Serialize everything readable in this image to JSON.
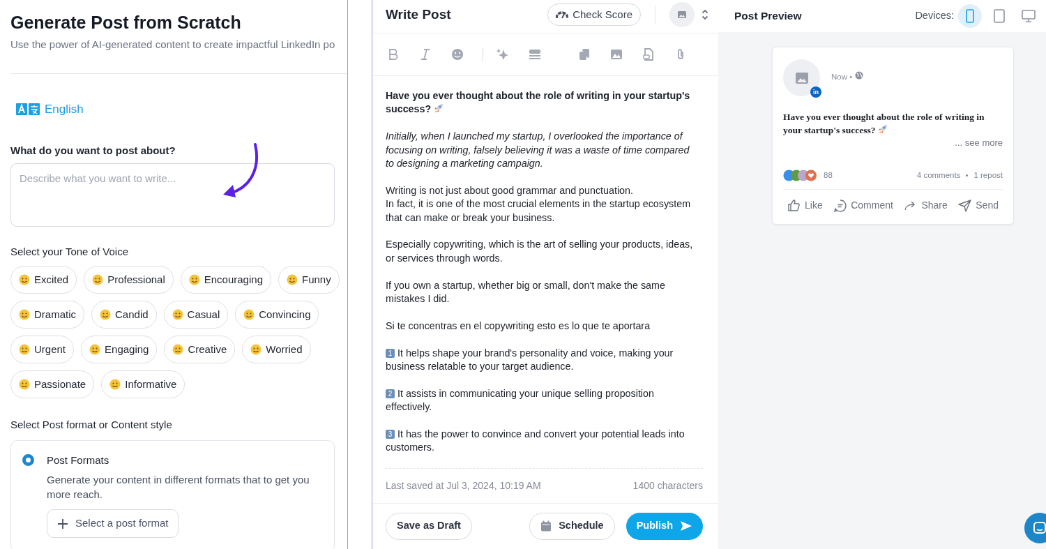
{
  "generator": {
    "title": "Generate Post from Scratch",
    "subtitle": "Use the power of AI-generated content to create impactful LinkedIn po",
    "language": "English",
    "topic_label": "What do you want to post about?",
    "topic_placeholder": "Describe what you want to write...",
    "tone_label": "Select your Tone of Voice",
    "tones": [
      {
        "label": "Excited",
        "selected": false
      },
      {
        "label": "Professional",
        "selected": false
      },
      {
        "label": "Encouraging",
        "selected": false
      },
      {
        "label": "Funny",
        "selected": false
      },
      {
        "label": "Dramatic",
        "selected": false
      },
      {
        "label": "Candid",
        "selected": false
      },
      {
        "label": "Casual",
        "selected": false
      },
      {
        "label": "Convincing",
        "selected": false
      },
      {
        "label": "Urgent",
        "selected": false
      },
      {
        "label": "Engaging",
        "selected": false
      },
      {
        "label": "Creative",
        "selected": false
      },
      {
        "label": "Worried",
        "selected": false
      },
      {
        "label": "Passionate",
        "selected": false
      },
      {
        "label": "Informative",
        "selected": false
      }
    ],
    "format_label": "Select Post format or Content style",
    "format_option": {
      "title": "Post Formats",
      "description": "Generate your content in different formats that to get you more reach.",
      "selected": true,
      "button": "Select a post format"
    }
  },
  "editor": {
    "title": "Write Post",
    "check_score": "Check Score",
    "toolbar": [
      {
        "kind": "bold"
      },
      {
        "kind": "italic"
      },
      {
        "kind": "emoji"
      },
      {
        "kind": "divider"
      },
      {
        "kind": "sparkle"
      },
      {
        "kind": "lines"
      },
      {
        "kind": "spacer"
      },
      {
        "kind": "copy"
      },
      {
        "kind": "image"
      },
      {
        "kind": "file"
      },
      {
        "kind": "attach"
      }
    ],
    "paragraphs": [
      {
        "kind": "bold",
        "text": "Have you ever thought about the role of writing in your startup's success?",
        "rocket": true
      },
      {
        "kind": "italic",
        "text": "Initially, when I launched my startup, I overlooked the importance of focusing on writing, falsely believing it was a waste of time compared to designing a marketing campaign."
      },
      {
        "kind": "plain",
        "text": "Writing is not just about good grammar and punctuation.\nIn fact, it is one of the most crucial elements in the startup ecosystem that can make or break your business."
      },
      {
        "kind": "plain",
        "text": "Especially copywriting, which is the art of selling your products, ideas, or services through words."
      },
      {
        "kind": "plain",
        "text": "If you own a startup, whether big or small, don't make the same mistakes I did."
      },
      {
        "kind": "plain",
        "text": "Si te concentras en el copywriting esto es lo que te aportara"
      },
      {
        "kind": "numbered",
        "number": "1",
        "text": "It helps shape your brand's personality and voice, making your business relatable to your target audience."
      },
      {
        "kind": "numbered",
        "number": "2",
        "text": "It assists in communicating your unique selling proposition effectively."
      },
      {
        "kind": "numbered",
        "number": "3",
        "text": "It has the power to convince and convert your potential leads into customers."
      }
    ],
    "last_saved": "Last saved at Jul 3, 2024, 10:19 AM",
    "char_count": "1400 characters",
    "save_draft": "Save as Draft",
    "schedule": "Schedule",
    "publish": "Publish"
  },
  "preview": {
    "title": "Post Preview",
    "devices_label": "Devices:",
    "devices": [
      {
        "kind": "phone",
        "selected": true
      },
      {
        "kind": "tablet",
        "selected": false
      },
      {
        "kind": "desktop",
        "selected": false
      }
    ],
    "post": {
      "network_badge": "in",
      "time": "Now •",
      "text": "Have you ever thought about the role of writing in your startup's success?",
      "see_more": "... see more",
      "reactions_count": "88",
      "comments": "4 comments",
      "reposts": "1 repost",
      "actions": [
        {
          "kind": "like",
          "label": "Like"
        },
        {
          "kind": "comment",
          "label": "Comment"
        },
        {
          "kind": "share",
          "label": "Share"
        },
        {
          "kind": "send",
          "label": "Send"
        }
      ]
    }
  }
}
